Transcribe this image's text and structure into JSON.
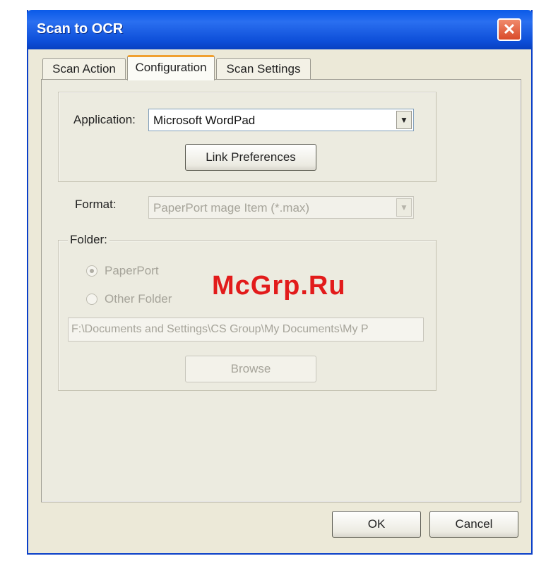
{
  "window": {
    "title": "Scan to OCR",
    "close_glyph": "✕"
  },
  "tabs": [
    {
      "label": "Scan Action"
    },
    {
      "label": "Configuration"
    },
    {
      "label": "Scan Settings"
    }
  ],
  "application": {
    "label": "Application:",
    "value": "Microsoft WordPad",
    "link_button": "Link Preferences"
  },
  "format": {
    "label": "Format:",
    "value": "PaperPort mage Item (*.max)"
  },
  "folder": {
    "label": "Folder:",
    "options": [
      {
        "label": "PaperPort",
        "checked": true
      },
      {
        "label": "Other Folder",
        "checked": false
      }
    ],
    "path": "F:\\Documents and Settings\\CS Group\\My Documents\\My P",
    "browse_button": "Browse"
  },
  "buttons": {
    "ok": "OK",
    "cancel": "Cancel"
  },
  "watermark": "McGrp.Ru",
  "icons": {
    "close": "close-icon",
    "dropdown": "chevron-down-icon"
  }
}
